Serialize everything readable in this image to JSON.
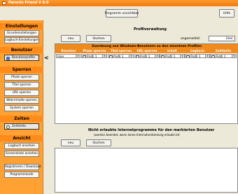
{
  "window": {
    "title": "Parents Friend V 8.0"
  },
  "topbar": {
    "protect_button": "Programm unsichtbar",
    "help_button": "Hilfe"
  },
  "sidebar": {
    "sections": [
      {
        "title": "Einstellungen",
        "items": [
          "Grundeinstellungen",
          "Logbuch-Einstellungen"
        ]
      },
      {
        "title": "Benutzer",
        "items": [
          "Benutzerprofile"
        ]
      },
      {
        "title": "Sperren",
        "items": [
          "Pfade sperren",
          "Titel sperren",
          "URL sperren",
          "Web-Inhalte sperren",
          "System sperren"
        ]
      },
      {
        "title": "Zeiten",
        "items": [
          "Zeitlimits"
        ]
      },
      {
        "title": "Ansicht",
        "items": [
          "Logbuch ansehen",
          "Screenshots ansehen"
        ]
      },
      {
        "title": "",
        "items": [
          "Registrieren / Download",
          "Programmende"
        ]
      }
    ],
    "active_item": "Benutzerprofile"
  },
  "profile": {
    "heading": "Profilverwaltung",
    "new_button": "neu",
    "delete_button": "löschen",
    "logged_in_label": "angemeldet:",
    "logged_in_value": "User"
  },
  "assignment": {
    "title": "Zuordnung von Windows-Benutzern zu den einzelnen Profilen",
    "columns": [
      "Benutzer",
      "Pfade sperren",
      "Titel sperren",
      "URL sperren",
      "Inhalt",
      "Logbuch",
      "Zeitlimits"
    ],
    "rows": [
      [
        "User",
        "Profil 1",
        "Profil 1",
        "Profil 1",
        "Profil 1",
        "Profil 1",
        "Profil 1"
      ]
    ]
  },
  "programs": {
    "heading": "Nicht erlaubte Internetprogramme für den markierten Benutzer",
    "subheading": "(werden beendet, wenn keine Internetverbindung erlaubt ist)",
    "new_button": "neu",
    "delete_button": "löschen"
  },
  "colors": {
    "accent": "#f08a1c",
    "sidebar": "#ffa133",
    "background": "#ece9d8"
  }
}
